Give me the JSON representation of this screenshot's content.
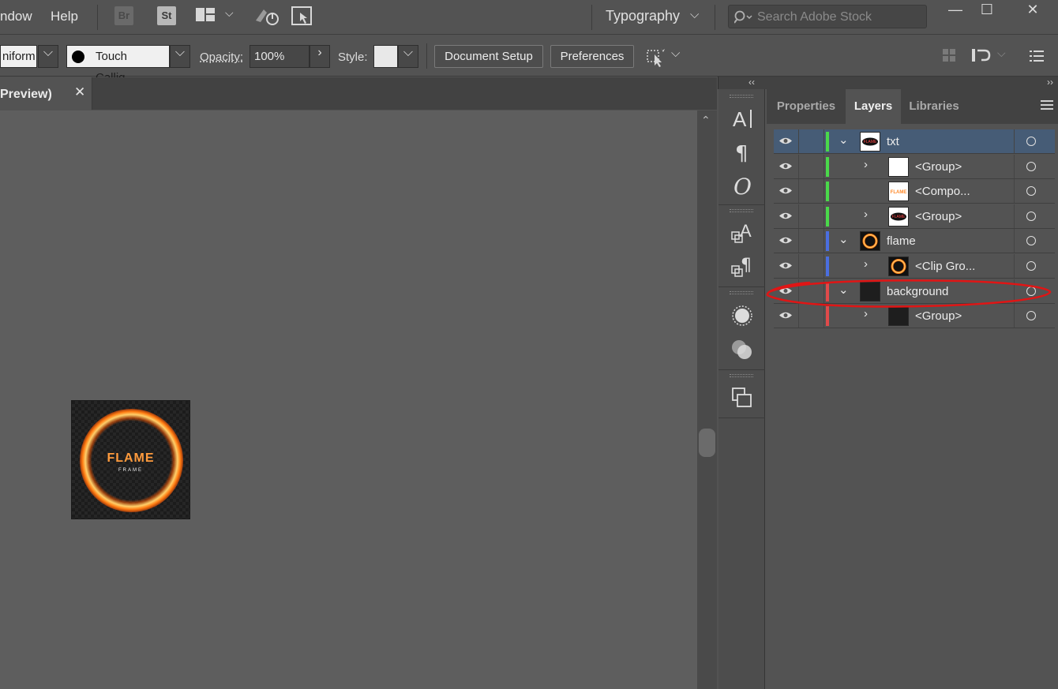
{
  "menubar": {
    "items": [
      "ndow",
      "Help"
    ],
    "apps": [
      "Br",
      "St"
    ],
    "workspace": "Typography",
    "search_placeholder": "Search Adobe Stock"
  },
  "controlbar": {
    "stroke_profile": "niform",
    "brush": "Touch Callig...",
    "opacity_label": "Opacity:",
    "opacity_value": "100%",
    "style_label": "Style:",
    "document_setup": "Document Setup",
    "preferences": "Preferences"
  },
  "document": {
    "tab_title": "Preview)",
    "close_glyph": "✕",
    "art_title": "FLAME",
    "art_subtitle": "FRAME"
  },
  "panel": {
    "tabs": [
      "Properties",
      "Layers",
      "Libraries"
    ],
    "active_tab": "Layers",
    "layers": [
      {
        "name": "txt",
        "level": 0,
        "expanded": true,
        "has_arrow": true,
        "color": "#4ad94a",
        "selected": true,
        "thumb": "txt"
      },
      {
        "name": "<Group>",
        "level": 1,
        "expanded": false,
        "has_arrow": true,
        "color": "#4ad94a",
        "selected": false,
        "thumb": "white"
      },
      {
        "name": "<Compo...",
        "level": 1,
        "expanded": false,
        "has_arrow": false,
        "color": "#4ad94a",
        "selected": false,
        "thumb": "flame-text"
      },
      {
        "name": "<Group>",
        "level": 1,
        "expanded": false,
        "has_arrow": true,
        "color": "#4ad94a",
        "selected": false,
        "thumb": "txt"
      },
      {
        "name": "flame",
        "level": 0,
        "expanded": true,
        "has_arrow": true,
        "color": "#4a6ee0",
        "selected": false,
        "thumb": "ring"
      },
      {
        "name": "<Clip Gro...",
        "level": 1,
        "expanded": false,
        "has_arrow": true,
        "color": "#4a6ee0",
        "selected": false,
        "thumb": "ring"
      },
      {
        "name": "background",
        "level": 0,
        "expanded": true,
        "has_arrow": true,
        "color": "#e04a4a",
        "selected": false,
        "thumb": "dark"
      },
      {
        "name": "<Group>",
        "level": 1,
        "expanded": false,
        "has_arrow": true,
        "color": "#e04a4a",
        "selected": false,
        "thumb": "dark"
      }
    ]
  }
}
